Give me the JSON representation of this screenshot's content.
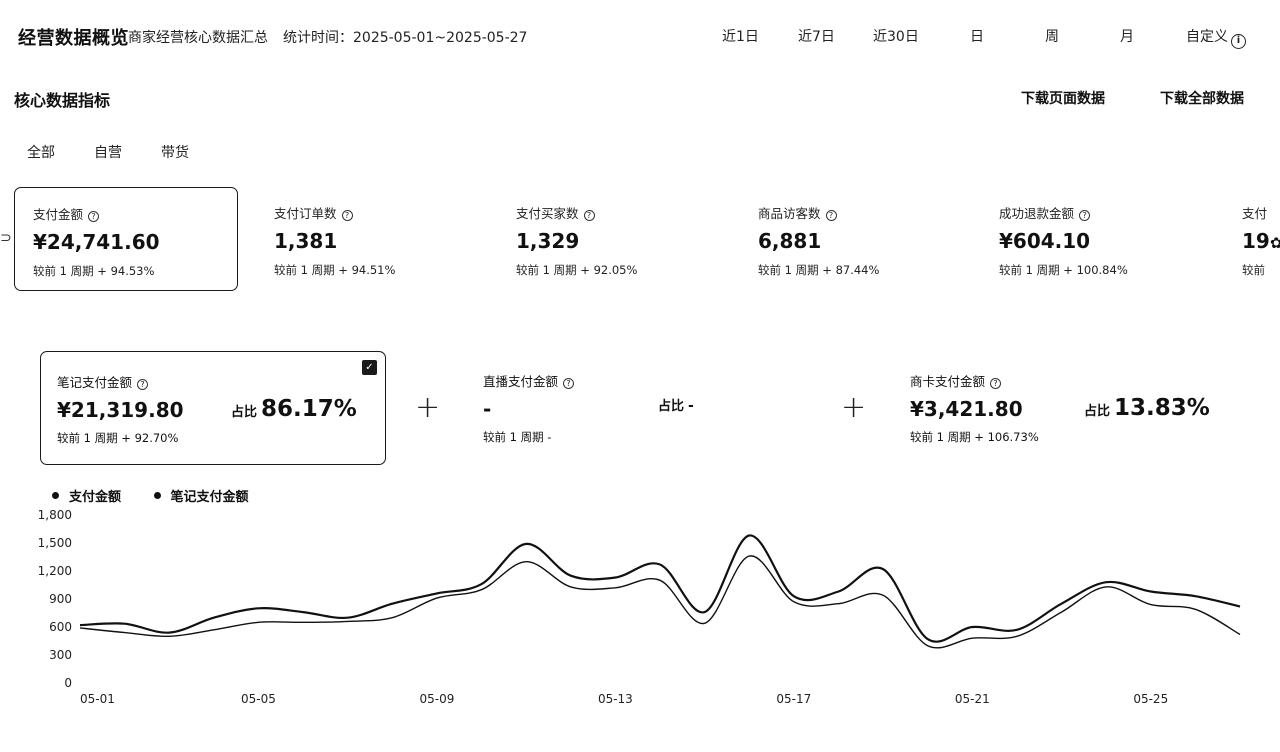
{
  "header": {
    "title": "经营数据概览",
    "subtitle": "商家经营核心数据汇总",
    "period": "统计时间：2025-05-01~2025-05-27",
    "range_tabs": [
      "近1日",
      "近7日",
      "近30日",
      "日",
      "周",
      "月",
      "自定义"
    ]
  },
  "section": {
    "title": "核心数据指标",
    "download_page": "下载页面数据",
    "download_all": "下载全部数据"
  },
  "scope_tabs": [
    "全部",
    "自营",
    "带货"
  ],
  "metrics": [
    {
      "label": "支付金额",
      "value": "¥24,741.60",
      "compare": "较前 1 周期  + 94.53%"
    },
    {
      "label": "支付订单数",
      "value": "1,381",
      "compare": "较前 1 周期  + 94.51%"
    },
    {
      "label": "支付买家数",
      "value": "1,329",
      "compare": "较前 1 周期  + 92.05%"
    },
    {
      "label": "商品访客数",
      "value": "6,881",
      "compare": "较前 1 周期  + 87.44%"
    },
    {
      "label": "成功退款金额",
      "value": "¥604.10",
      "compare": "较前 1 周期  + 100.84%"
    },
    {
      "label": "支付",
      "value": "19",
      "compare": "较前"
    }
  ],
  "channels": [
    {
      "label": "笔记支付金额",
      "value": "¥21,319.80",
      "compare": "较前 1 周期  + 92.70%",
      "share_label": "占比",
      "share": "86.17%"
    },
    {
      "label": "直播支付金额",
      "value": "-",
      "compare": "较前 1 周期  -",
      "share_label": "占比",
      "share": "-"
    },
    {
      "label": "商卡支付金额",
      "value": "¥3,421.80",
      "compare": "较前 1 周期  + 106.73%",
      "share_label": "占比",
      "share": "13.83%"
    }
  ],
  "chart_data": {
    "type": "line",
    "x": [
      "05-01",
      "05-02",
      "05-03",
      "05-04",
      "05-05",
      "05-06",
      "05-07",
      "05-08",
      "05-09",
      "05-10",
      "05-11",
      "05-12",
      "05-13",
      "05-14",
      "05-15",
      "05-16",
      "05-17",
      "05-18",
      "05-19",
      "05-20",
      "05-21",
      "05-22",
      "05-23",
      "05-24",
      "05-25",
      "05-26",
      "05-27"
    ],
    "x_tick_labels": [
      "05-01",
      "05-05",
      "05-09",
      "05-13",
      "05-17",
      "05-21",
      "05-25"
    ],
    "y_ticks": [
      "0",
      "300",
      "600",
      "900",
      "1,200",
      "1,500",
      "1,800"
    ],
    "ylim": [
      0,
      1800
    ],
    "series": [
      {
        "name": "支付金额",
        "values": [
          620,
          635,
          540,
          700,
          800,
          760,
          700,
          850,
          960,
          1060,
          1490,
          1150,
          1130,
          1270,
          760,
          1580,
          930,
          980,
          1220,
          470,
          600,
          570,
          850,
          1080,
          980,
          930,
          820
        ]
      },
      {
        "name": "笔记支付金额",
        "values": [
          590,
          540,
          500,
          570,
          650,
          650,
          660,
          700,
          910,
          1000,
          1300,
          1030,
          1020,
          1100,
          640,
          1360,
          870,
          850,
          940,
          400,
          480,
          500,
          760,
          1030,
          840,
          790,
          520
        ]
      }
    ],
    "legend": "top-left"
  }
}
